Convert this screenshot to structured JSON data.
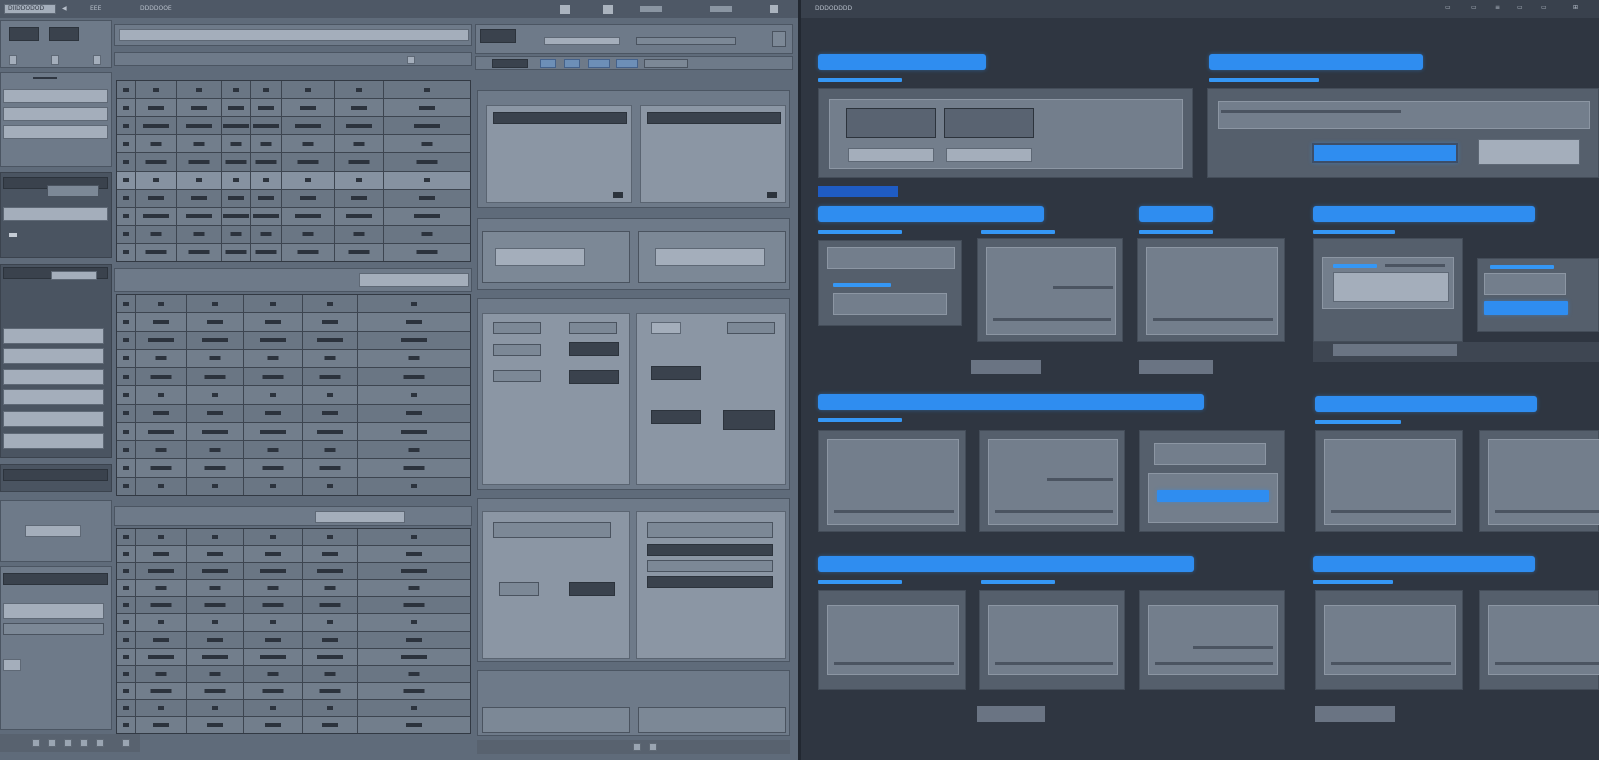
{
  "left_app": {
    "title": "DIIDDODOD",
    "menu": [
      "◀",
      "EEE",
      "DDDDOOE"
    ]
  },
  "right_app": {
    "title": "DDDODDDD",
    "window_icons": [
      "▭",
      "▭",
      "≡",
      "▭",
      "▭",
      "⊞"
    ]
  },
  "colors": {
    "accent_blue": "#2f8df0",
    "left_bg": "#5f6b7a",
    "right_bg": "#2f3641"
  }
}
